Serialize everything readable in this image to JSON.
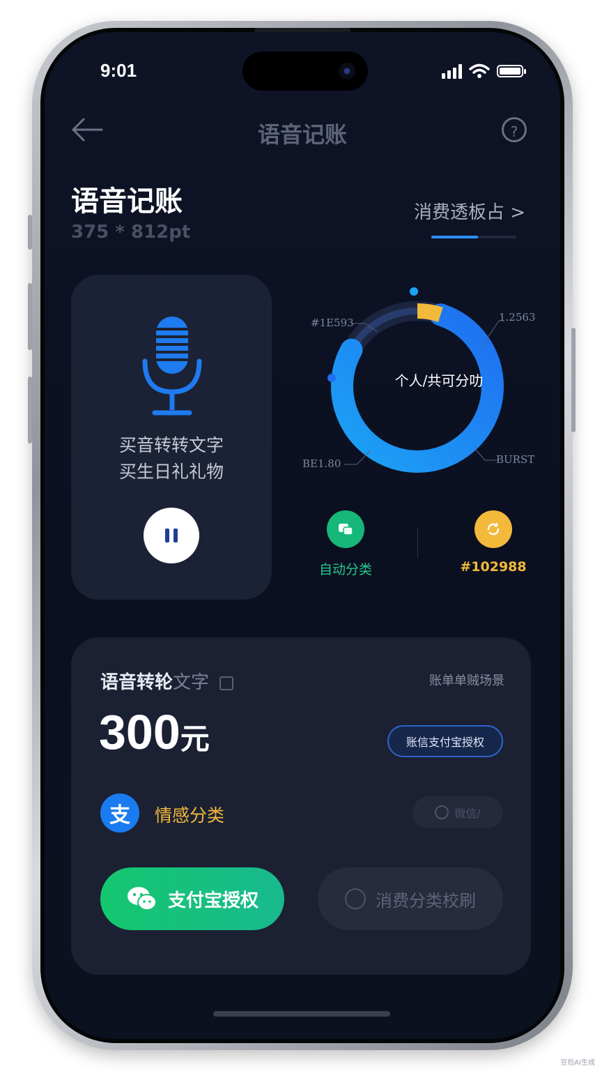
{
  "status": {
    "time": "9:01"
  },
  "nav": {
    "title": "语音记账"
  },
  "header": {
    "title": "语音记账",
    "subtitle": "375 * 812pt",
    "report_link": "消费透板占 >",
    "report_progress": 0.55
  },
  "voice_card": {
    "line1": "买音转转文字",
    "line2": "买生日礼礼物"
  },
  "donut": {
    "center_label": "个人/共可分叻",
    "labels": [
      "#1E593",
      "1.2563",
      "BE1.80",
      "BURST"
    ],
    "percent_blue": 0.78,
    "percent_dark": 0.17,
    "percent_orange": 0.05
  },
  "features": {
    "auto_label": "自动分类",
    "code_label": "#102988"
  },
  "record": {
    "title_bold": "语音转轮",
    "title_faded": "文字",
    "scene": "账单单贼场景",
    "amount": "300",
    "amount_unit": "元",
    "auth_pill": "账信支付宝授权",
    "category": "情感分类",
    "wechat_pill": "微信/",
    "alipay_button": "支付宝授权",
    "calibrate_button": "消费分类校刷"
  },
  "colors": {
    "accent_blue": "#2f8fff",
    "green": "#15c76f",
    "orange": "#f2b93b"
  },
  "watermark": "豆包AI生成"
}
